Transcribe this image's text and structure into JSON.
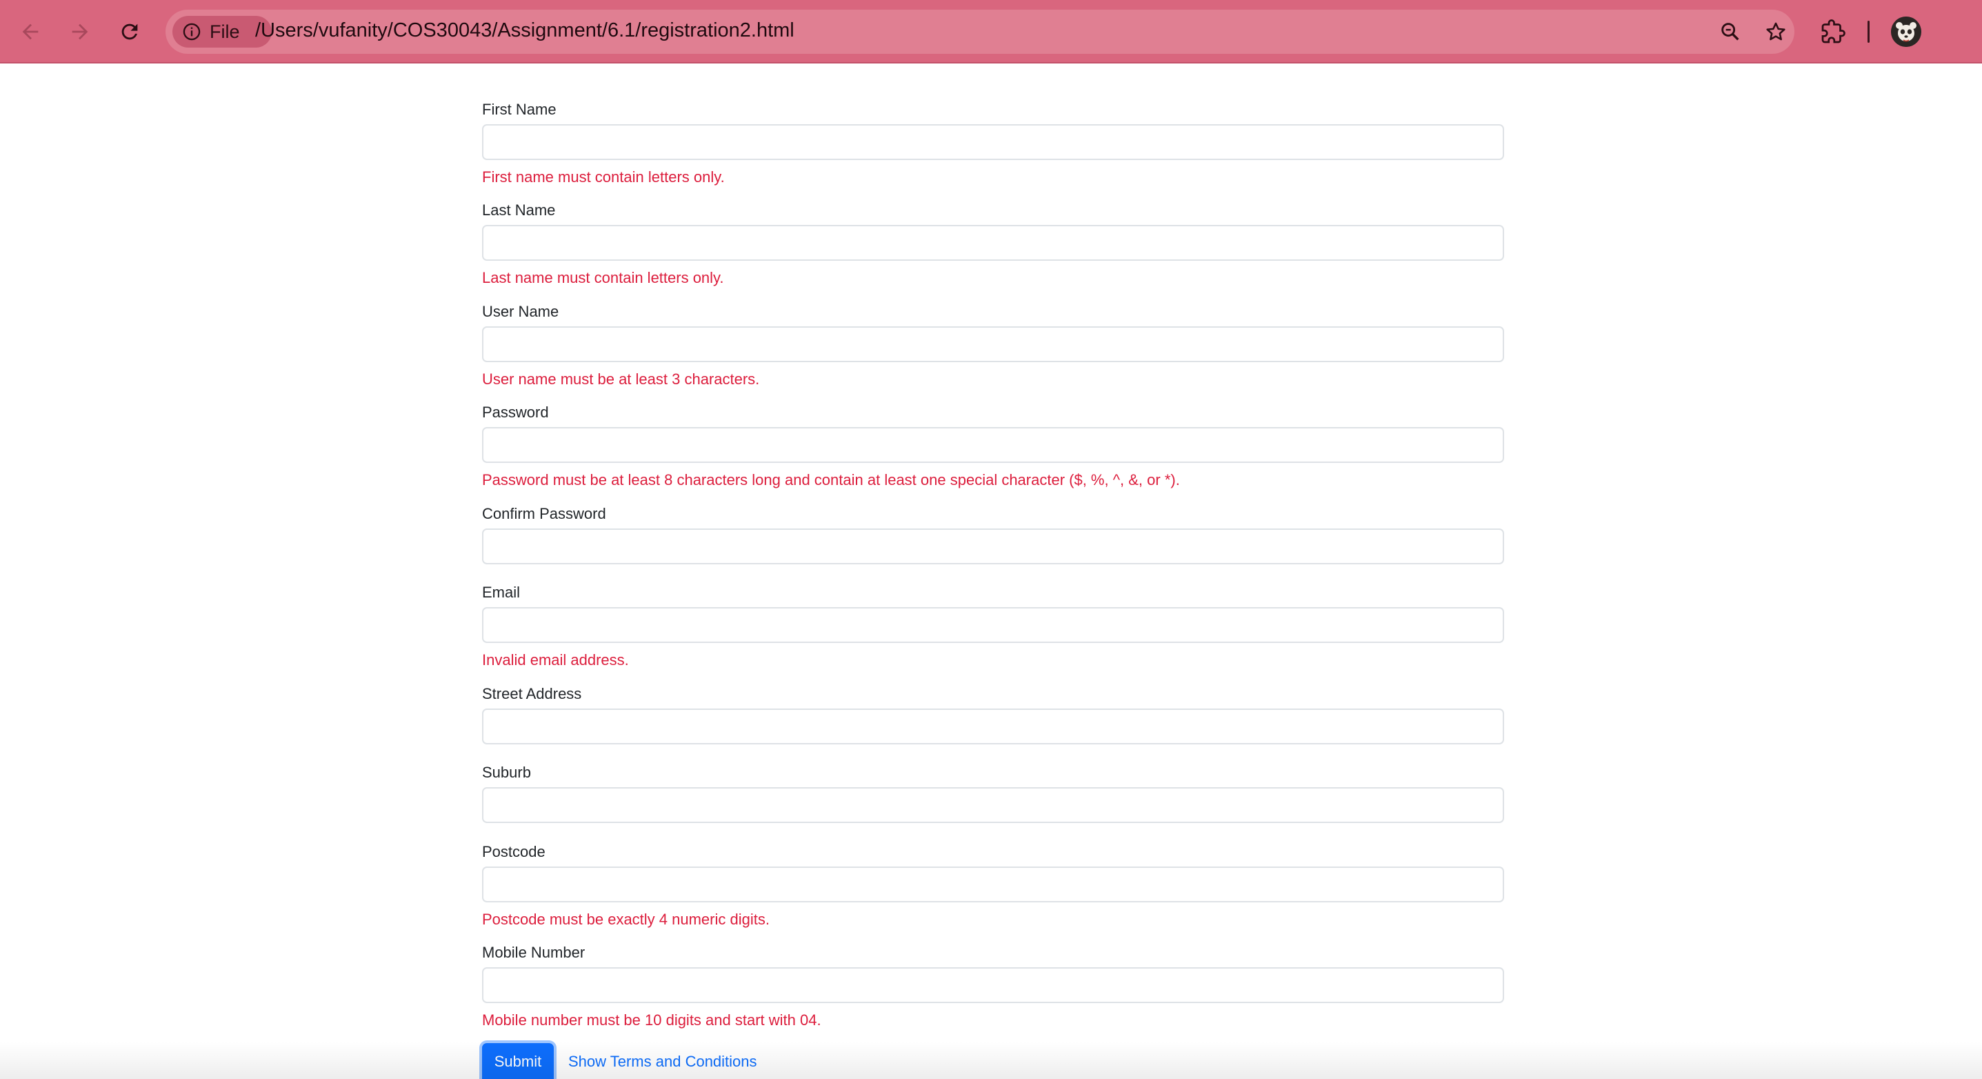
{
  "browser": {
    "site_chip_label": "File",
    "url": "/Users/vufanity/COS30043/Assignment/6.1/registration2.html",
    "icons": [
      "back-icon",
      "forward-icon",
      "reload-icon",
      "info-icon",
      "zoom-icon",
      "star-icon",
      "extensions-icon",
      "profile-avatar"
    ]
  },
  "form": {
    "fields": [
      {
        "label": "First Name",
        "value": "",
        "error": "First name must contain letters only."
      },
      {
        "label": "Last Name",
        "value": "",
        "error": "Last name must contain letters only."
      },
      {
        "label": "User Name",
        "value": "",
        "error": "User name must be at least 3 characters."
      },
      {
        "label": "Password",
        "value": "",
        "error": "Password must be at least 8 characters long and contain at least one special character ($, %, ^, &, or *)."
      },
      {
        "label": "Confirm Password",
        "value": "",
        "error": ""
      },
      {
        "label": "Email",
        "value": "",
        "error": "Invalid email address."
      },
      {
        "label": "Street Address",
        "value": "",
        "error": ""
      },
      {
        "label": "Suburb",
        "value": "",
        "error": ""
      },
      {
        "label": "Postcode",
        "value": "",
        "error": "Postcode must be exactly 4 numeric digits."
      },
      {
        "label": "Mobile Number",
        "value": "",
        "error": "Mobile number must be 10 digits and start with 04."
      }
    ],
    "submit_label": "Submit",
    "terms_link": "Show Terms and Conditions"
  },
  "colors": {
    "toolbar": "#d9667e",
    "omnibox": "#e07f92",
    "error_text": "#dc1d3c",
    "primary": "#0d6efd",
    "input_border": "#dee2e6"
  }
}
